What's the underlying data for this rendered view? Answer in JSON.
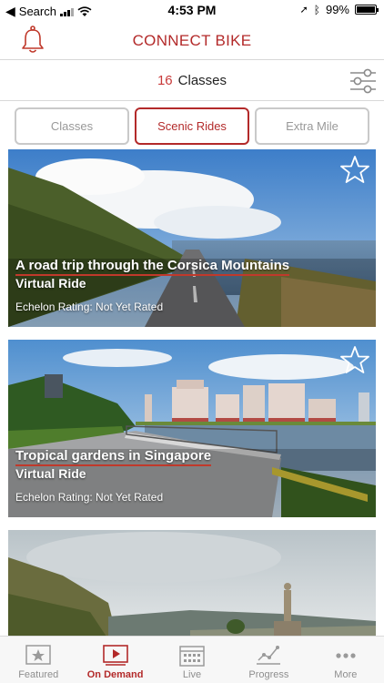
{
  "status": {
    "back_app": "Search",
    "time": "4:53 PM",
    "battery": "99%",
    "battery_level": 0.99
  },
  "header": {
    "title": "CONNECT BIKE",
    "left_icon": "bell-icon"
  },
  "classbar": {
    "count": "16",
    "label": "Classes",
    "filter_icon": "sliders-icon"
  },
  "segments": [
    {
      "label": "Classes",
      "active": false
    },
    {
      "label": "Scenic Rides",
      "active": true
    },
    {
      "label": "Extra Mile",
      "active": false
    }
  ],
  "cards": [
    {
      "title": "A road trip through the Corsica Mountains",
      "subtitle": "Virtual Ride",
      "rating": "Echelon Rating: Not Yet Rated"
    },
    {
      "title": "Tropical gardens in Singapore",
      "subtitle": "Virtual Ride",
      "rating": "Echelon Rating: Not Yet Rated"
    },
    {
      "title": "",
      "subtitle": "",
      "rating": ""
    }
  ],
  "tabs": [
    {
      "label": "Featured",
      "icon": "featured-star-icon",
      "active": false
    },
    {
      "label": "On Demand",
      "icon": "video-play-icon",
      "active": true
    },
    {
      "label": "Live",
      "icon": "calendar-icon",
      "active": false
    },
    {
      "label": "Progress",
      "icon": "chart-icon",
      "active": false
    },
    {
      "label": "More",
      "icon": "more-dots-icon",
      "active": false
    }
  ],
  "colors": {
    "accent": "#b32a2a",
    "inactive": "#999999",
    "divider": "#d8d8d8"
  }
}
